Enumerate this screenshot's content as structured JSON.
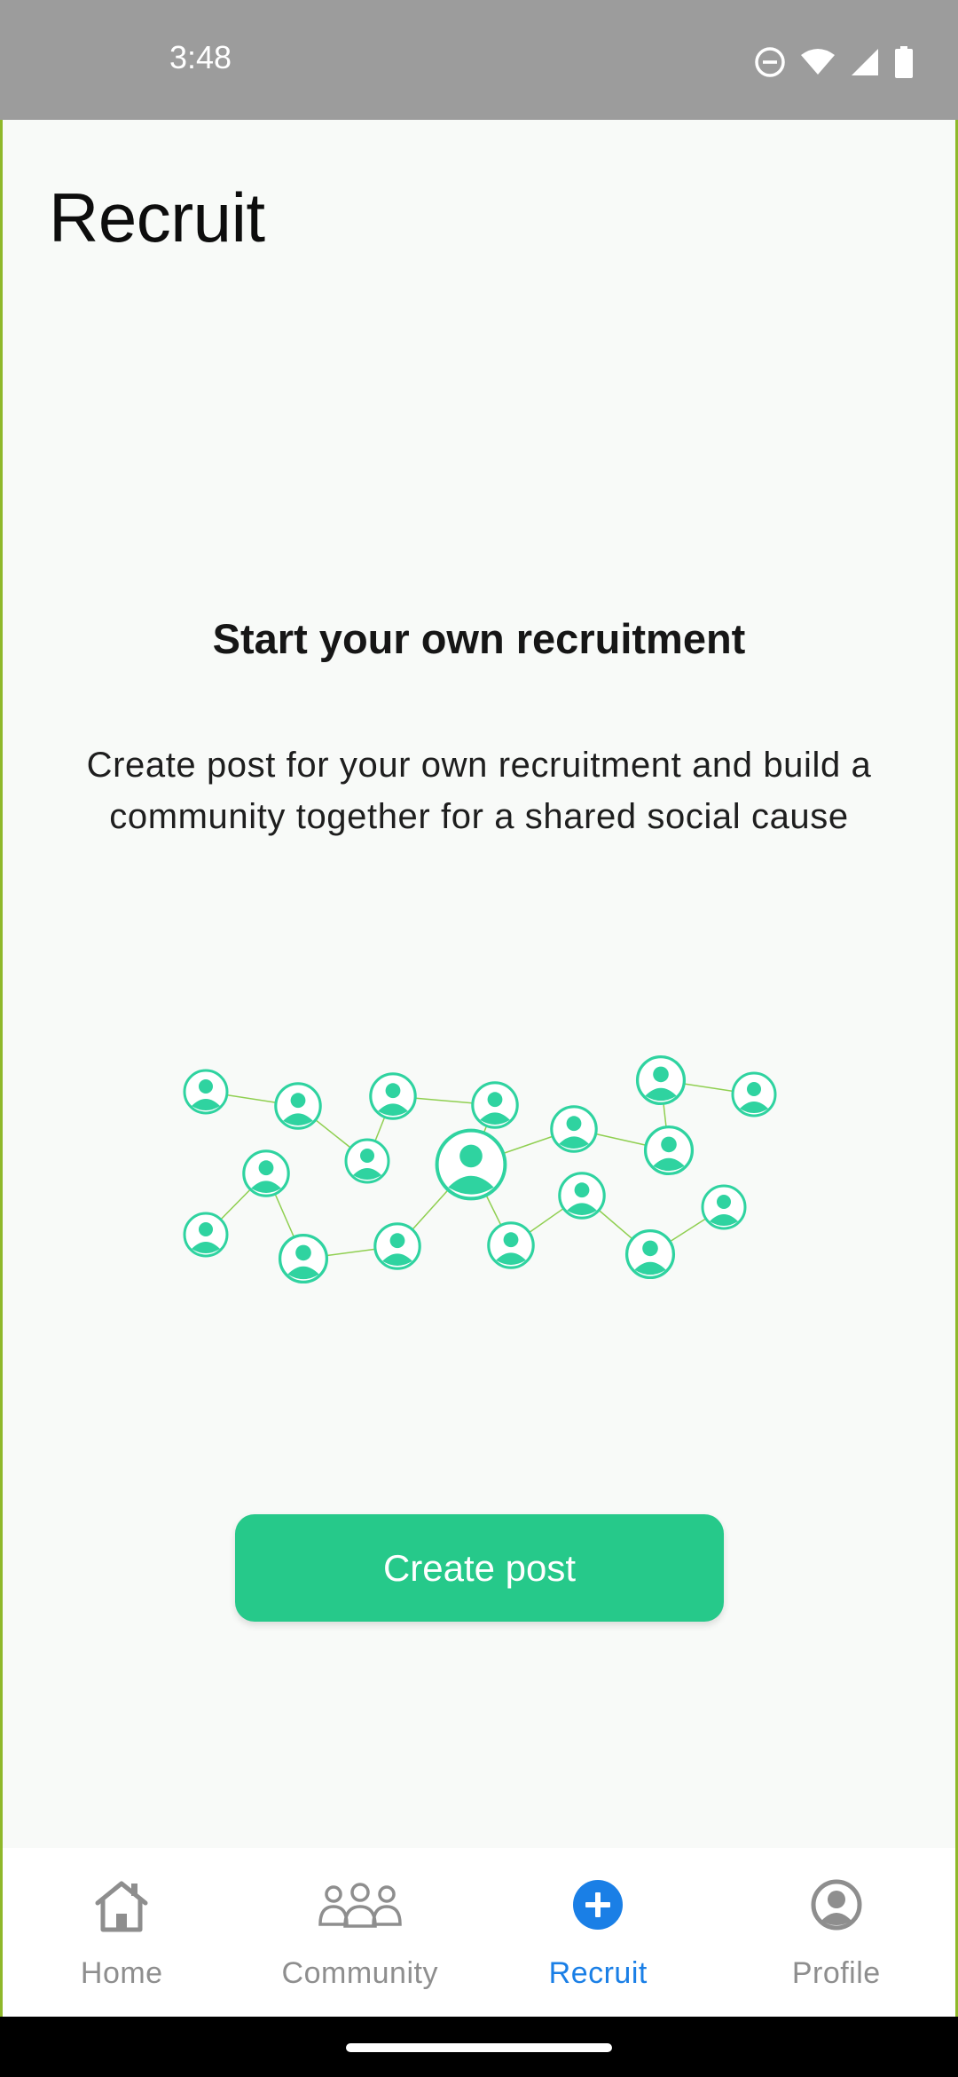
{
  "status_bar": {
    "time": "3:48",
    "icons": [
      "do-not-disturb-icon",
      "wifi-icon",
      "cellular-signal-icon",
      "battery-icon"
    ]
  },
  "page": {
    "title": "Recruit",
    "headline": "Start your own recruitment",
    "description": "Create post for your own recruitment and build a community together for a shared social cause"
  },
  "illustration": {
    "name": "community-network-illustration",
    "accent_color": "#2fd3a0",
    "line_color": "#8fcf50"
  },
  "actions": {
    "create_post_label": "Create post",
    "button_color": "#26c98a"
  },
  "bottom_nav": {
    "items": [
      {
        "label": "Home",
        "icon": "home-icon",
        "active": false
      },
      {
        "label": "Community",
        "icon": "community-icon",
        "active": false
      },
      {
        "label": "Recruit",
        "icon": "add-circle-icon",
        "active": true
      },
      {
        "label": "Profile",
        "icon": "profile-icon",
        "active": false
      }
    ],
    "active_color": "#1a7fe6",
    "inactive_color": "#8e8e8e"
  }
}
